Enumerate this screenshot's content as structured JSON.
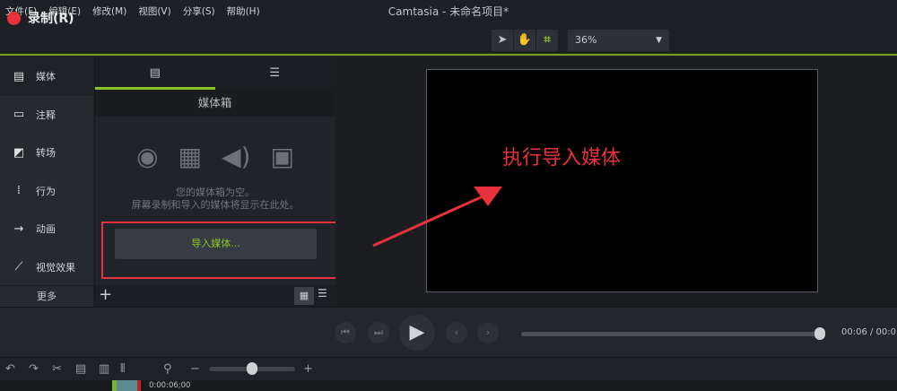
{
  "menu": [
    "文件(F)",
    "编辑(E)",
    "修改(M)",
    "视图(V)",
    "分享(S)",
    "帮助(H)"
  ],
  "window_title": "Camtasia - 未命名项目*",
  "record_label": "录制(R)",
  "zoom_value": "36%",
  "sidebar": {
    "items": [
      {
        "label": "媒体",
        "icon": "film-icon"
      },
      {
        "label": "注释",
        "icon": "callout-icon"
      },
      {
        "label": "转场",
        "icon": "transition-icon"
      },
      {
        "label": "行为",
        "icon": "behavior-icon"
      },
      {
        "label": "动画",
        "icon": "animation-icon"
      },
      {
        "label": "视觉效果",
        "icon": "wand-icon"
      }
    ],
    "more": "更多"
  },
  "panel": {
    "title": "媒体箱",
    "empty_line1": "您的媒体箱为空。",
    "empty_line2": "屏幕录制和导入的媒体将显示在此处。",
    "import_button": "导入媒体..."
  },
  "annotation": "执行导入媒体",
  "playback": {
    "time": "00:06 / 00:0"
  },
  "timeline": {
    "timecode": "0:00:06;00"
  },
  "colors": {
    "accent": "#8bc42a",
    "annotation": "#e8313a",
    "record": "#e8313a"
  }
}
